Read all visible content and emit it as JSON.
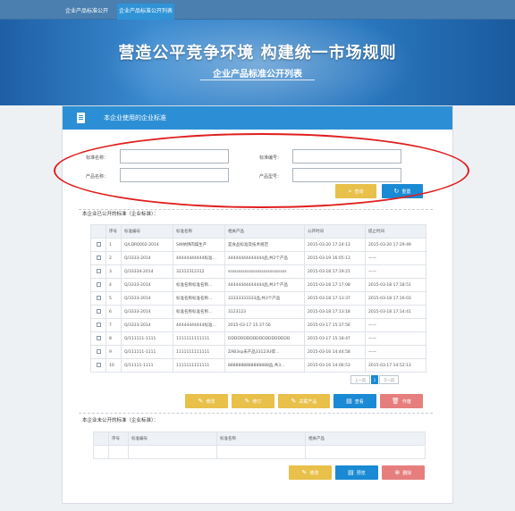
{
  "tabs": [
    "企业产品标准公开",
    "企业产品标准公开列表"
  ],
  "banner": {
    "title": "营造公平竞争环境 构建统一市场规则",
    "subtitle": "企业产品标准公开列表"
  },
  "panel": {
    "title": "本企业使用的企业标准"
  },
  "form": {
    "std_name_label": "标准名称：",
    "std_no_label": "标准编号：",
    "product_name_label": "产品名称：",
    "product_model_label": "产品型号：",
    "query_label": "查询",
    "reset_label": "重置"
  },
  "public_section": {
    "title": "本企业已公开的标准（企业标准）：",
    "headers": [
      "序号",
      "标准编号",
      "标准名称",
      "相关产品",
      "公开时间",
      "提止时间"
    ],
    "rows": [
      [
        "1",
        "Q/LDR0002-2014",
        "SW纳饼肉燥生产",
        "是食品标准及技术规范",
        "2015-03-20 17:24:13",
        "2015-03-20 17:29:49"
      ],
      [
        "2",
        "Q/3333-2014",
        "44444444444标准…",
        "44444444444444品,共2个产品",
        "2015-03-19 16:05:13",
        "——"
      ],
      [
        "3",
        "Q/33334-2014",
        "32312312312",
        "ssssssssssssssssssssssssssss",
        "2015-03-18 17:19:21",
        "——"
      ],
      [
        "4",
        "Q/3333-2014",
        "标准名称标准名称…",
        "44444444444444品,共3个产品",
        "2015-03-18 17:17:08",
        "2015-03-18 17:18:51"
      ],
      [
        "5",
        "Q/3333-2014",
        "标准名称标准名称…",
        "33333333333品,共3个产品",
        "2015-03-18 17:13:37",
        "2015-03-18 17:16:03"
      ],
      [
        "6",
        "Q/3333-2014",
        "标准名称标准名称…",
        "3123123",
        "2015-03-18 17:13:18",
        "2015-03-18 17:14:41"
      ],
      [
        "7",
        "Q/3333-2014",
        "44444444444标准…",
        "2015-03-17 15:37:56",
        "2015-03-17 15:37:56",
        "——"
      ],
      [
        "8",
        "Q/111111-1111",
        "1111111111111",
        "DDDDDDDDDDDDDDDDDDDD",
        "2015-03-17 15:18:47",
        "——"
      ],
      [
        "9",
        "Q/111111-1111",
        "1111111111111",
        "ZAB3sp未产品33123U得…",
        "2015-03-16 14:44:58",
        "——"
      ],
      [
        "10",
        "Q/11111-1111",
        "1111111111111",
        "8888888888888888品,共3…",
        "2015-03-16 14:06:53",
        "2015-03-17 14:52:13"
      ]
    ],
    "pager": {
      "prev": "上一页",
      "current": "1",
      "next": "下一页"
    },
    "actions": [
      "修改",
      "修订",
      "关联产品",
      "查看",
      "作废"
    ]
  },
  "private_section": {
    "title": "本企业未公开的标准（企业标准）：",
    "headers": [
      "序号",
      "标准编号",
      "标准名称",
      "相关产品"
    ],
    "actions": [
      "修改",
      "预览",
      "删除"
    ]
  },
  "colors": {
    "accent": "#2c8fd5",
    "yellow_btn": "#e8c04a",
    "blue_btn": "#1a8ad4",
    "red_btn": "#e67e7e",
    "highlight": "#e01e1e"
  }
}
